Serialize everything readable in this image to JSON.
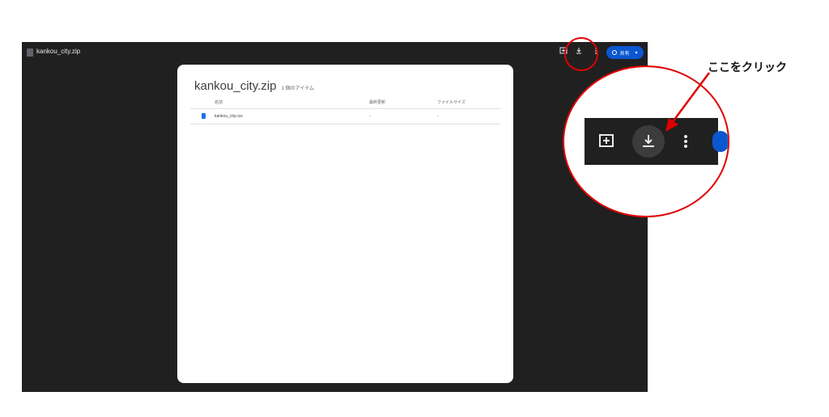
{
  "viewer": {
    "filename": "kankou_city.zip",
    "toolbar": {
      "comment_icon": "add-comment-icon",
      "download_icon": "download-icon",
      "more_icon": "more-vert-icon",
      "share_label": "共有"
    }
  },
  "card": {
    "title": "kankou_city.zip",
    "item_count": "1 個のアイテム",
    "columns": [
      "名前",
      "最終更新",
      "ファイルサイズ"
    ],
    "rows": [
      {
        "name": "kankou_city.csv",
        "modified": "-",
        "size": "-"
      }
    ]
  },
  "annotation": {
    "text": "ここをクリック",
    "color": "#e00000"
  },
  "colors": {
    "viewer_bg": "#202020",
    "accent": "#0b57d0"
  }
}
